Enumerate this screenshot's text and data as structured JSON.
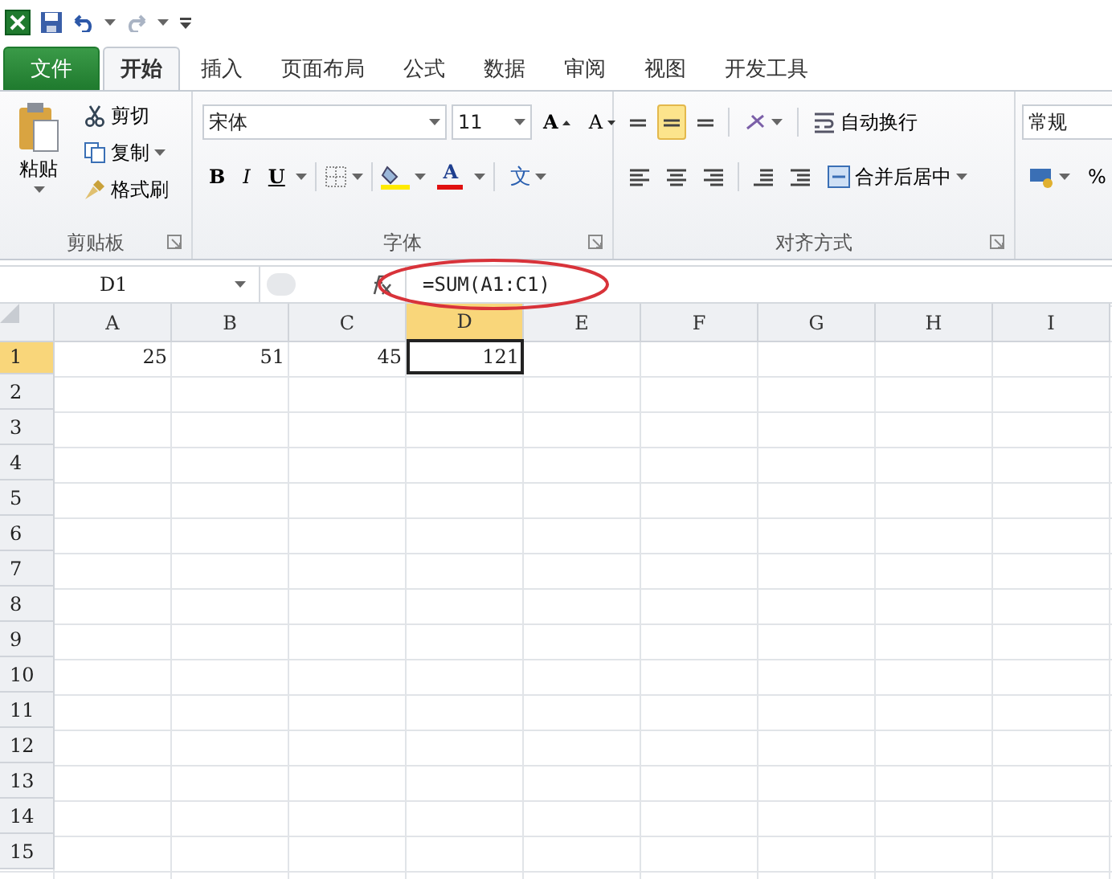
{
  "tabs": [
    {
      "label": "文件",
      "kind": "file",
      "selected": false
    },
    {
      "label": "开始",
      "kind": "tab",
      "selected": true
    },
    {
      "label": "插入",
      "kind": "tab",
      "selected": false
    },
    {
      "label": "页面布局",
      "kind": "tab",
      "selected": false
    },
    {
      "label": "公式",
      "kind": "tab",
      "selected": false
    },
    {
      "label": "数据",
      "kind": "tab",
      "selected": false
    },
    {
      "label": "审阅",
      "kind": "tab",
      "selected": false
    },
    {
      "label": "视图",
      "kind": "tab",
      "selected": false
    },
    {
      "label": "开发工具",
      "kind": "tab",
      "selected": false
    }
  ],
  "clipboard": {
    "label": "剪贴板",
    "paste": "粘贴",
    "cut": "剪切",
    "copy": "复制",
    "format_painter": "格式刷"
  },
  "font": {
    "label": "字体",
    "name": "宋体",
    "size": "11",
    "grow": "A",
    "shrink": "A",
    "bold": "B",
    "italic": "I",
    "underline": "U",
    "color_letter": "A",
    "phonetic": "文"
  },
  "alignment": {
    "label": "对齐方式",
    "wrap_text": "自动换行",
    "merge_center": "合并后居中",
    "middle_selected": true
  },
  "number": {
    "format": "常规",
    "percent": "%"
  },
  "formula_bar": {
    "name_box": "D1",
    "formula": "=SUM(A1:C1)"
  },
  "sheet": {
    "columns": [
      {
        "label": "A",
        "selected": false
      },
      {
        "label": "B",
        "selected": false
      },
      {
        "label": "C",
        "selected": false
      },
      {
        "label": "D",
        "selected": true
      },
      {
        "label": "E",
        "selected": false
      },
      {
        "label": "F",
        "selected": false
      },
      {
        "label": "G",
        "selected": false
      },
      {
        "label": "H",
        "selected": false
      },
      {
        "label": "I",
        "selected": false
      }
    ],
    "rows": [
      {
        "label": "1",
        "selected": true,
        "values": [
          "25",
          "51",
          "45",
          "121"
        ]
      },
      {
        "label": "2",
        "selected": false
      },
      {
        "label": "3",
        "selected": false
      },
      {
        "label": "4",
        "selected": false
      },
      {
        "label": "5",
        "selected": false
      },
      {
        "label": "6",
        "selected": false
      },
      {
        "label": "7",
        "selected": false
      },
      {
        "label": "8",
        "selected": false
      },
      {
        "label": "9",
        "selected": false
      },
      {
        "label": "10",
        "selected": false
      },
      {
        "label": "11",
        "selected": false
      },
      {
        "label": "12",
        "selected": false
      },
      {
        "label": "13",
        "selected": false
      },
      {
        "label": "14",
        "selected": false
      },
      {
        "label": "15",
        "selected": false
      }
    ]
  }
}
